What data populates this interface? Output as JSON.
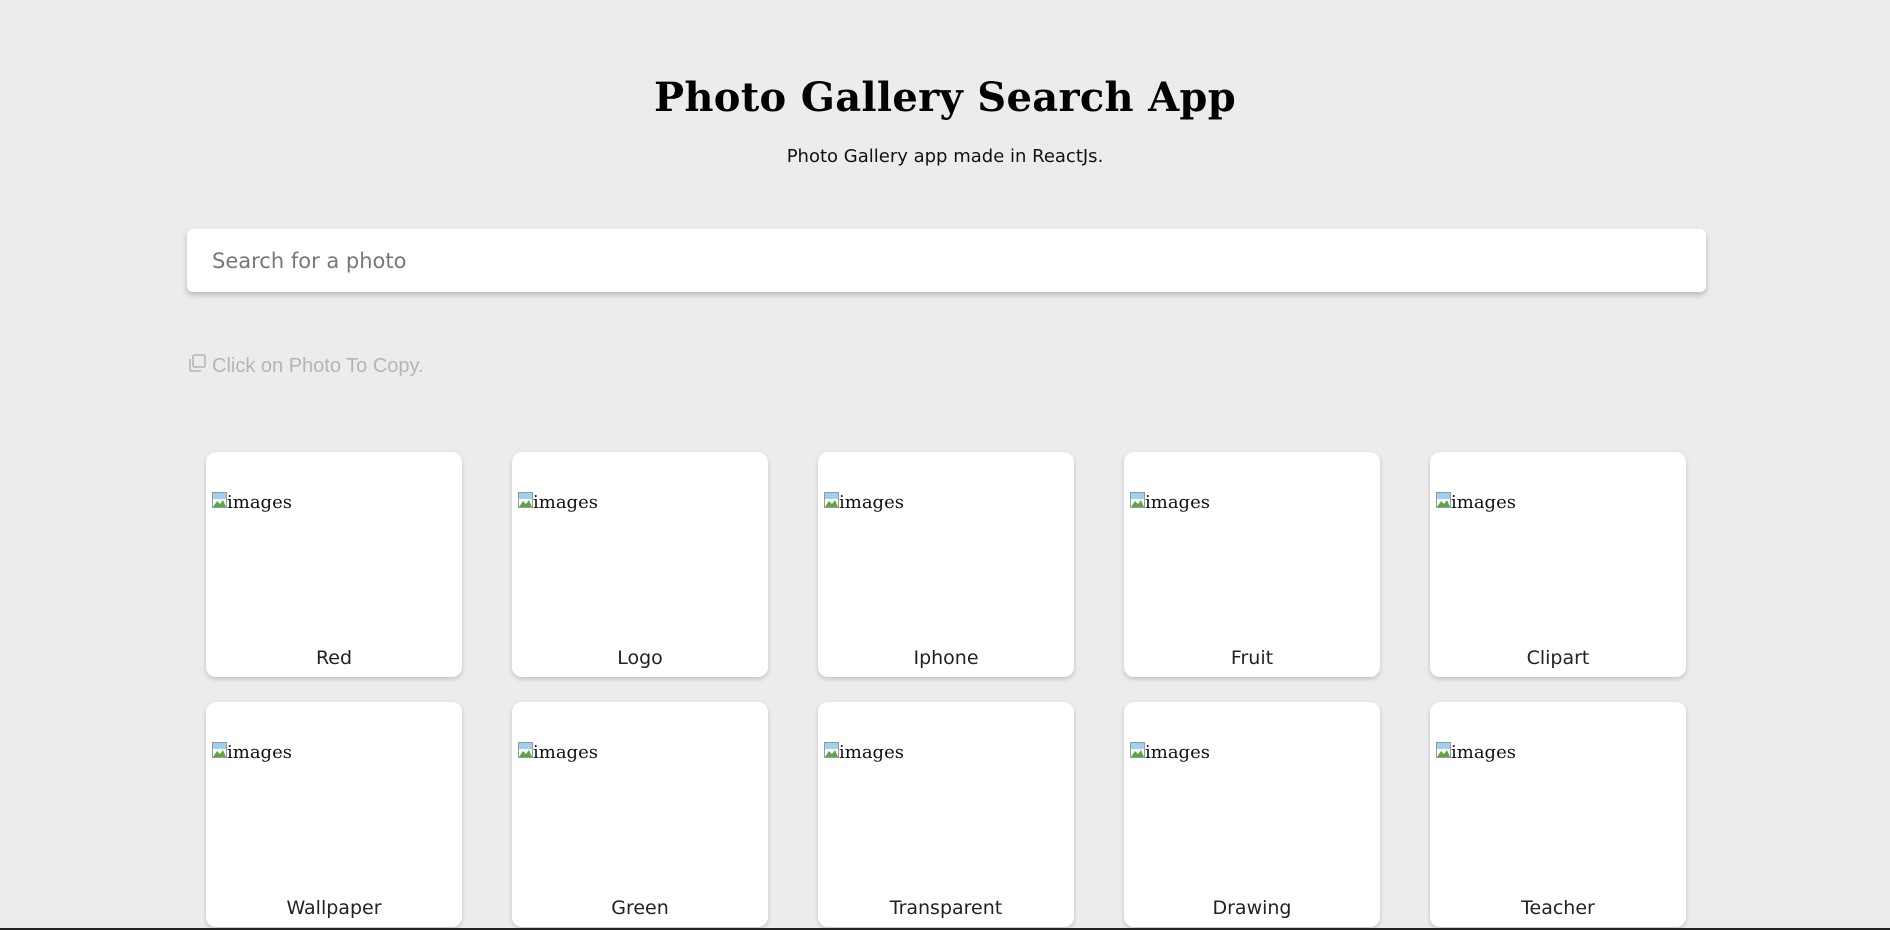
{
  "header": {
    "title": "Photo Gallery Search App",
    "subtitle": "Photo Gallery app made in ReactJs."
  },
  "search": {
    "placeholder": "Search for a photo",
    "value": ""
  },
  "hint": {
    "icon": "copy-icon",
    "text": "Click on Photo To Copy."
  },
  "gallery": {
    "image_alt": "images",
    "image_icon": "broken-image-icon",
    "cards": [
      {
        "label": "Red"
      },
      {
        "label": "Logo"
      },
      {
        "label": "Iphone"
      },
      {
        "label": "Fruit"
      },
      {
        "label": "Clipart"
      },
      {
        "label": "Wallpaper"
      },
      {
        "label": "Green"
      },
      {
        "label": "Transparent"
      },
      {
        "label": "Drawing"
      },
      {
        "label": "Teacher"
      }
    ]
  },
  "colors": {
    "background": "#ececec",
    "card": "#ffffff",
    "hint_text": "#b5b5b5"
  }
}
